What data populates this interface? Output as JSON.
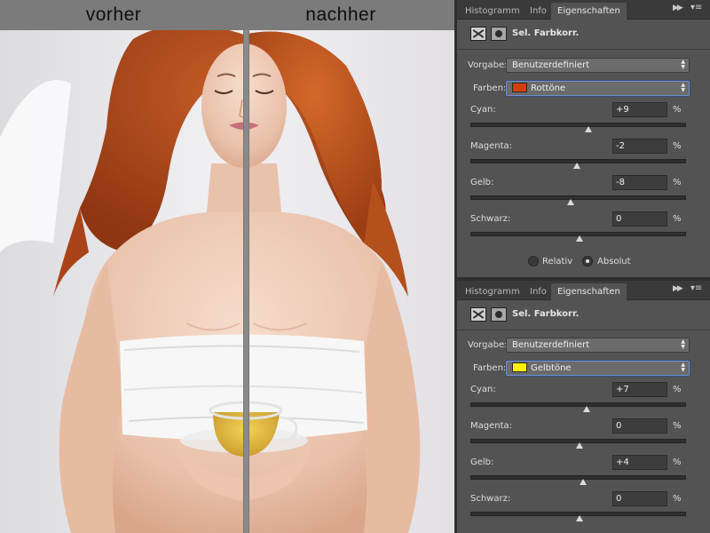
{
  "captions": {
    "before": "vorher",
    "after": "nachher"
  },
  "panels": [
    {
      "tabs": [
        "Histogramm",
        "Info",
        "Eigenschaften"
      ],
      "active_tab": 2,
      "title": "Sel. Farbkorr.",
      "preset_label": "Vorgabe:",
      "preset_value": "Benutzerdefiniert",
      "colors_label": "Farben:",
      "colors_value": "Rottöne",
      "swatch_color": "#d2400f",
      "sliders": [
        {
          "label": "Cyan:",
          "value": "+9",
          "unit": "%",
          "level": 9
        },
        {
          "label": "Magenta:",
          "value": "-2",
          "unit": "%",
          "level": -2
        },
        {
          "label": "Gelb:",
          "value": "-8",
          "unit": "%",
          "level": -8
        },
        {
          "label": "Schwarz:",
          "value": "0",
          "unit": "%",
          "level": 0
        }
      ],
      "method": {
        "relative": "Relativ",
        "absolute": "Absolut",
        "selected": "absolute"
      }
    },
    {
      "tabs": [
        "Histogramm",
        "Info",
        "Eigenschaften"
      ],
      "active_tab": 2,
      "title": "Sel. Farbkorr.",
      "preset_label": "Vorgabe:",
      "preset_value": "Benutzerdefiniert",
      "colors_label": "Farben:",
      "colors_value": "Gelbtöne",
      "swatch_color": "#fff200",
      "sliders": [
        {
          "label": "Cyan:",
          "value": "+7",
          "unit": "%",
          "level": 7
        },
        {
          "label": "Magenta:",
          "value": "0",
          "unit": "%",
          "level": 0
        },
        {
          "label": "Gelb:",
          "value": "+4",
          "unit": "%",
          "level": 4
        },
        {
          "label": "Schwarz:",
          "value": "0",
          "unit": "%",
          "level": 0
        }
      ]
    }
  ]
}
